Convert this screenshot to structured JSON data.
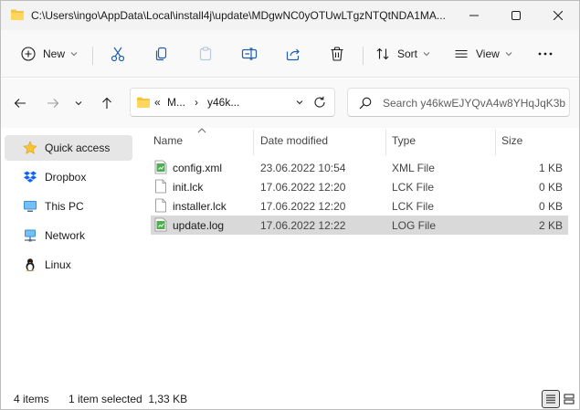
{
  "window": {
    "title": "C:\\Users\\ingo\\AppData\\Local\\install4j\\update\\MDgwNC0yOTUwLTgzNTQtNDA1MA..."
  },
  "toolbar": {
    "new_label": "New",
    "sort_label": "Sort",
    "view_label": "View"
  },
  "address": {
    "chevrons": "«",
    "crumb1": "M...",
    "separator": "›",
    "crumb2": "y46k..."
  },
  "search": {
    "placeholder": "Search y46kwEJYQvA4w8YHqJqK3b..."
  },
  "sidebar": {
    "items": [
      {
        "label": "Quick access",
        "icon": "star-icon",
        "selected": true
      },
      {
        "label": "Dropbox",
        "icon": "dropbox-icon",
        "selected": false
      },
      {
        "label": "This PC",
        "icon": "computer-icon",
        "selected": false
      },
      {
        "label": "Network",
        "icon": "network-icon",
        "selected": false
      },
      {
        "label": "Linux",
        "icon": "linux-icon",
        "selected": false
      }
    ]
  },
  "table": {
    "columns": [
      "Name",
      "Date modified",
      "Type",
      "Size"
    ],
    "rows": [
      {
        "name": "config.xml",
        "date": "23.06.2022 10:54",
        "type": "XML File",
        "size": "1 KB",
        "icon": "xml-file-icon",
        "selected": false
      },
      {
        "name": "init.lck",
        "date": "17.06.2022 12:20",
        "type": "LCK File",
        "size": "0 KB",
        "icon": "blank-file-icon",
        "selected": false
      },
      {
        "name": "installer.lck",
        "date": "17.06.2022 12:20",
        "type": "LCK File",
        "size": "0 KB",
        "icon": "blank-file-icon",
        "selected": false
      },
      {
        "name": "update.log",
        "date": "17.06.2022 12:22",
        "type": "LOG File",
        "size": "2 KB",
        "icon": "log-file-icon",
        "selected": true
      }
    ]
  },
  "status": {
    "count": "4 items",
    "selection": "1 item selected  1,33 KB"
  },
  "colors": {
    "accent": "#0067c0",
    "folder": "#f5c542",
    "selection": "#d9d9d9"
  }
}
